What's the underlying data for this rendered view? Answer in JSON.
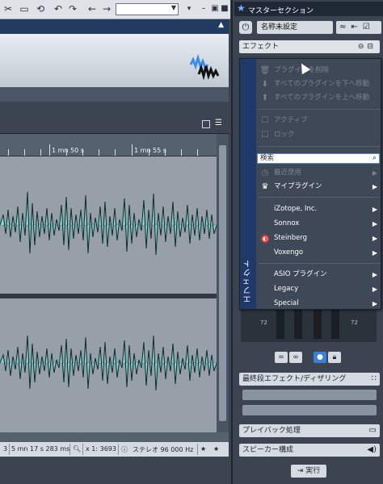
{
  "toolbar": {
    "icons": [
      "scissors-icon",
      "document-icon",
      "history-icon",
      "undo-icon",
      "redo-icon",
      "back-arrow-icon",
      "forward-arrow-icon"
    ],
    "dropdown_value": "",
    "right_icons": [
      "menu-icon",
      "minimize-icon",
      "restore-icon",
      "close-icon"
    ]
  },
  "ruler": {
    "labels": [
      "1 mn 50 s",
      "1 mn 55 s"
    ]
  },
  "status": {
    "duration": "5 mn 17 s 283 ms",
    "zoom": "x 1: 3693",
    "format": "ステレオ 96 000 Hz"
  },
  "master": {
    "title": "マスターセクション",
    "preset_name": "名称未設定",
    "effects_label": "エフェクト",
    "meter_left": "72",
    "meter_right": "72",
    "final_stage_label": "最終段エフェクト/ディザリング",
    "playback_label": "プレイバック処理",
    "speaker_label": "スピーカー構成",
    "run_label": "実行"
  },
  "menu": {
    "vertical_label": "エフェクト",
    "items_top": [
      {
        "label": "プラグインを削除",
        "icon": "trash-icon"
      },
      {
        "label": "すべてのプラグインを下へ移動",
        "icon": "down-arrow-icon"
      },
      {
        "label": "すべてのプラグインを上へ移動",
        "icon": "up-arrow-icon"
      },
      {
        "label": "アクティブ",
        "icon": "checkbox-icon"
      },
      {
        "label": "ロック",
        "icon": "checkbox-icon"
      }
    ],
    "search_placeholder": "検索",
    "items_mid": [
      {
        "label": "最近使用",
        "icon": "recent-icon"
      },
      {
        "label": "マイプラグイン",
        "icon": "crown-icon"
      }
    ],
    "vendors": [
      "iZotope, Inc.",
      "Sonnox",
      "Steinberg",
      "Voxengo"
    ],
    "bottom": [
      "ASIO プラグイン",
      "Legacy",
      "Special"
    ]
  }
}
